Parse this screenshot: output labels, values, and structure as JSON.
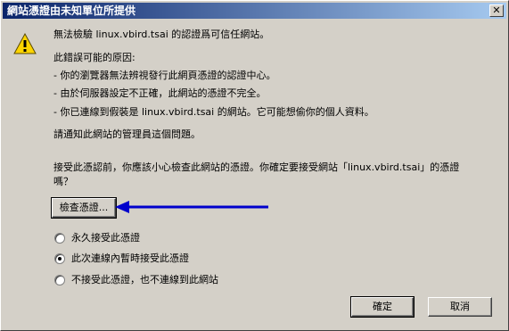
{
  "window": {
    "title": "網站憑證由未知單位所提供",
    "close_label": "✕"
  },
  "message": {
    "line1": "無法檢驗 linux.vbird.tsai 的認證爲可信任網站。",
    "reasons_title": "此錯誤可能的原因:",
    "reason1": "- 你的瀏覽器無法辨視發行此網頁憑證的認證中心。",
    "reason2": "- 由於伺服器設定不正確，此網站的憑證不完全。",
    "reason3": "- 你已連線到假裝是 linux.vbird.tsai 的網站。它可能想偷你的個人資料。",
    "notify": "請通知此網站的管理員這個問題。",
    "question_line1": "接受此憑認前，你應該小心檢查此網站的憑證。你確定要接受網站「linux.vbird.tsai」的憑證",
    "question_line2": "嗎？"
  },
  "buttons": {
    "view_cert": "檢查憑證...",
    "ok": "確定",
    "cancel": "取消"
  },
  "options": [
    {
      "label": "永久接受此憑證",
      "selected": false
    },
    {
      "label": "此次連線內暫時接受此憑證",
      "selected": true
    },
    {
      "label": "不接受此憑證，也不連線到此網站",
      "selected": false
    }
  ],
  "icons": {
    "warning": "warning-icon",
    "arrow": "arrow-left-icon"
  },
  "colors": {
    "title_start": "#0a246a",
    "title_end": "#a6caf0",
    "arrow": "#0000cc",
    "window_bg": "#d4d0c8"
  }
}
